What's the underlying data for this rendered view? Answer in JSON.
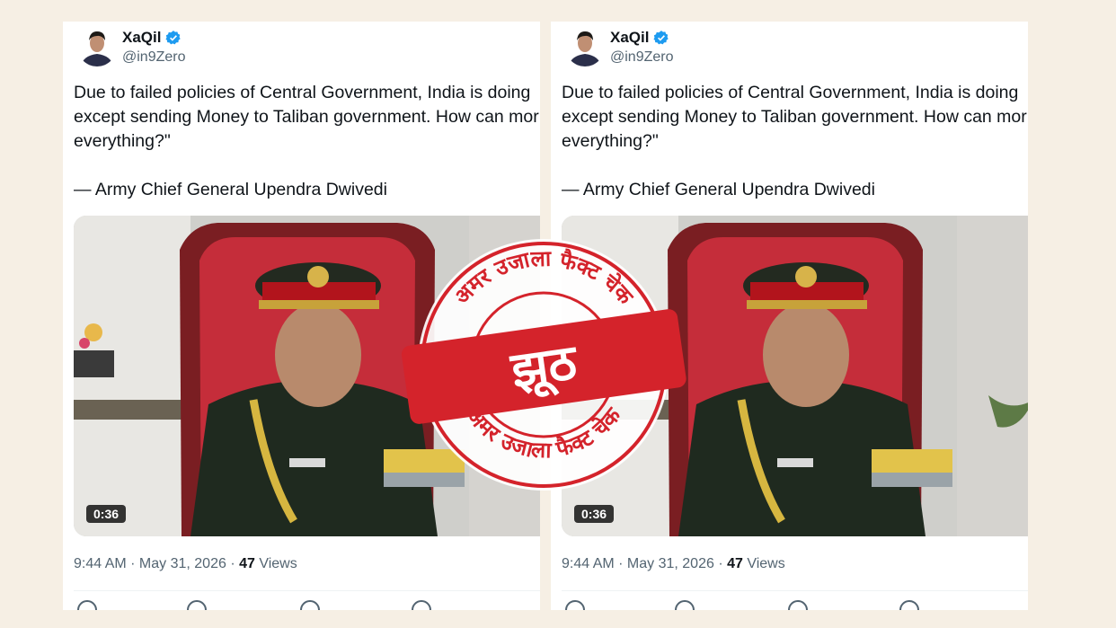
{
  "tweets": [
    {
      "author_name": "XaQil",
      "handle": "@in9Zero",
      "text_lines": [
        "Due to failed policies of Central Government, India is doing",
        "except sending Money to Taliban government. How can mor",
        "everything?\""
      ],
      "attribution": "— Army Chief General Upendra Dwivedi",
      "video_duration": "0:36",
      "time": "9:44 AM",
      "date": "May 31, 2026",
      "views_count": "47",
      "views_label": "Views"
    },
    {
      "author_name": "XaQil",
      "handle": "@in9Zero",
      "text_lines": [
        "Due to failed policies of Central Government, India is doing",
        "except sending Money to Taliban government. How can mor",
        "everything?\""
      ],
      "attribution": "— Army Chief General Upendra Dwivedi",
      "video_duration": "0:36",
      "time": "9:44 AM",
      "date": "May 31, 2026",
      "views_count": "47",
      "views_label": "Views"
    }
  ],
  "stamp": {
    "top_text": "अमर उजाला फैक्ट चेक",
    "verdict": "झूठ",
    "bottom_text": "अमर उजाला फैक्ट चेक",
    "color": "#d4232b"
  },
  "colors": {
    "verified": "#1d9bf0",
    "text": "#0f1419",
    "muted": "#536471",
    "background": "#f6efe4"
  }
}
